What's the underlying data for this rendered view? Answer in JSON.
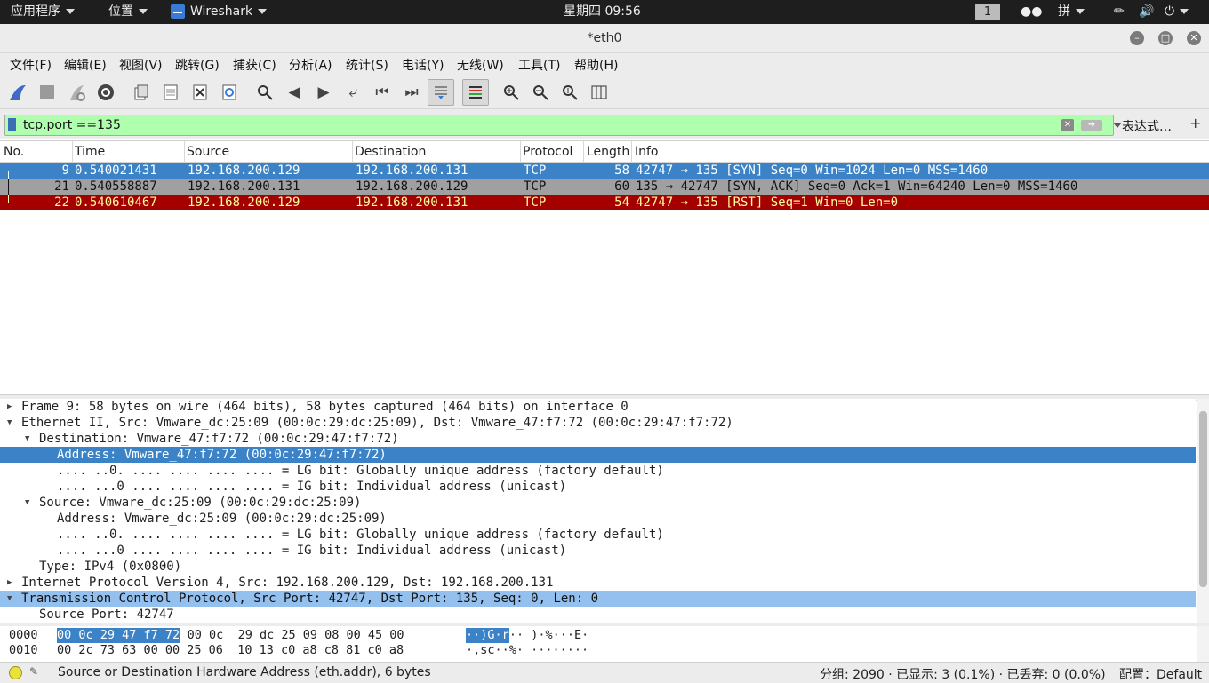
{
  "topbar": {
    "apps": "应用程序",
    "places": "位置",
    "app_name": "Wireshark",
    "clock": "星期四 09:56",
    "workspace": "1",
    "input_method": "拼"
  },
  "window": {
    "title": "*eth0"
  },
  "menu": [
    "文件(F)",
    "编辑(E)",
    "视图(V)",
    "跳转(G)",
    "捕获(C)",
    "分析(A)",
    "统计(S)",
    "电话(Y)",
    "无线(W)",
    "工具(T)",
    "帮助(H)"
  ],
  "filter": {
    "value": "tcp.port ==135",
    "expression_label": "表达式…",
    "add_label": "+"
  },
  "packet_list": {
    "columns": [
      "No.",
      "Time",
      "Source",
      "Destination",
      "Protocol",
      "Length",
      "Info"
    ],
    "rows": [
      {
        "no": "9",
        "time": "0.540021431",
        "src": "192.168.200.129",
        "dst": "192.168.200.131",
        "proto": "TCP",
        "len": "58",
        "info": "42747 → 135 [SYN] Seq=0 Win=1024 Len=0 MSS=1460",
        "bg": "#3b83c6",
        "fg": "#ffffff"
      },
      {
        "no": "21",
        "time": "0.540558887",
        "src": "192.168.200.131",
        "dst": "192.168.200.129",
        "proto": "TCP",
        "len": "60",
        "info": "135 → 42747 [SYN, ACK] Seq=0 Ack=1 Win=64240 Len=0 MSS=1460",
        "bg": "#a0a0a0",
        "fg": "#111111"
      },
      {
        "no": "22",
        "time": "0.540610467",
        "src": "192.168.200.129",
        "dst": "192.168.200.131",
        "proto": "TCP",
        "len": "54",
        "info": "42747 → 135 [RST] Seq=1 Win=0 Len=0",
        "bg": "#a40000",
        "fg": "#fffc9c"
      }
    ]
  },
  "details": [
    {
      "text": "Frame 9: 58 bytes on wire (464 bits), 58 bytes captured (464 bits) on interface 0",
      "indent": 0,
      "arrow": "right",
      "style": ""
    },
    {
      "text": "Ethernet II, Src: Vmware_dc:25:09 (00:0c:29:dc:25:09), Dst: Vmware_47:f7:72 (00:0c:29:47:f7:72)",
      "indent": 0,
      "arrow": "down",
      "style": ""
    },
    {
      "text": "Destination: Vmware_47:f7:72 (00:0c:29:47:f7:72)",
      "indent": 1,
      "arrow": "down",
      "style": ""
    },
    {
      "text": "Address: Vmware_47:f7:72 (00:0c:29:47:f7:72)",
      "indent": 2,
      "arrow": "",
      "style": "selected"
    },
    {
      "text": ".... ..0. .... .... .... .... = LG bit: Globally unique address (factory default)",
      "indent": 2,
      "arrow": "",
      "style": ""
    },
    {
      "text": ".... ...0 .... .... .... .... = IG bit: Individual address (unicast)",
      "indent": 2,
      "arrow": "",
      "style": ""
    },
    {
      "text": "Source: Vmware_dc:25:09 (00:0c:29:dc:25:09)",
      "indent": 1,
      "arrow": "down",
      "style": ""
    },
    {
      "text": "Address: Vmware_dc:25:09 (00:0c:29:dc:25:09)",
      "indent": 2,
      "arrow": "",
      "style": ""
    },
    {
      "text": ".... ..0. .... .... .... .... = LG bit: Globally unique address (factory default)",
      "indent": 2,
      "arrow": "",
      "style": ""
    },
    {
      "text": ".... ...0 .... .... .... .... = IG bit: Individual address (unicast)",
      "indent": 2,
      "arrow": "",
      "style": ""
    },
    {
      "text": "Type: IPv4 (0x0800)",
      "indent": 1,
      "arrow": "",
      "style": ""
    },
    {
      "text": "Internet Protocol Version 4, Src: 192.168.200.129, Dst: 192.168.200.131",
      "indent": 0,
      "arrow": "right",
      "style": ""
    },
    {
      "text": "Transmission Control Protocol, Src Port: 42747, Dst Port: 135, Seq: 0, Len: 0",
      "indent": 0,
      "arrow": "down",
      "style": "hover"
    },
    {
      "text": "Source Port: 42747",
      "indent": 1,
      "arrow": "",
      "style": ""
    }
  ],
  "bytes": [
    {
      "offset": "0000",
      "hex_hl": "00 0c 29 47 f7 72",
      "hex_rest": " 00 0c  29 dc 25 09 08 00 45 00",
      "ascii_hl": "··)G·r",
      "ascii_rest": "·· )·%···E·"
    },
    {
      "offset": "0010",
      "hex_hl": "",
      "hex_rest": "00 2c 73 63 00 00 25 06  10 13 c0 a8 c8 81 c0 a8",
      "ascii_hl": "",
      "ascii_rest": "·,sc··%· ········"
    }
  ],
  "status": {
    "field_info": "Source or Destination Hardware Address (eth.addr), 6 bytes",
    "counts": "分组: 2090 · 已显示: 3 (0.1%) · 已丢弃: 0 (0.0%)",
    "profile": "配置：Default"
  },
  "colors": {
    "selected_row": "#3b83c6",
    "filter_ok": "#afffaf",
    "tcp_rst_bg": "#a40000",
    "tcp_rst_fg": "#fffc9c"
  }
}
